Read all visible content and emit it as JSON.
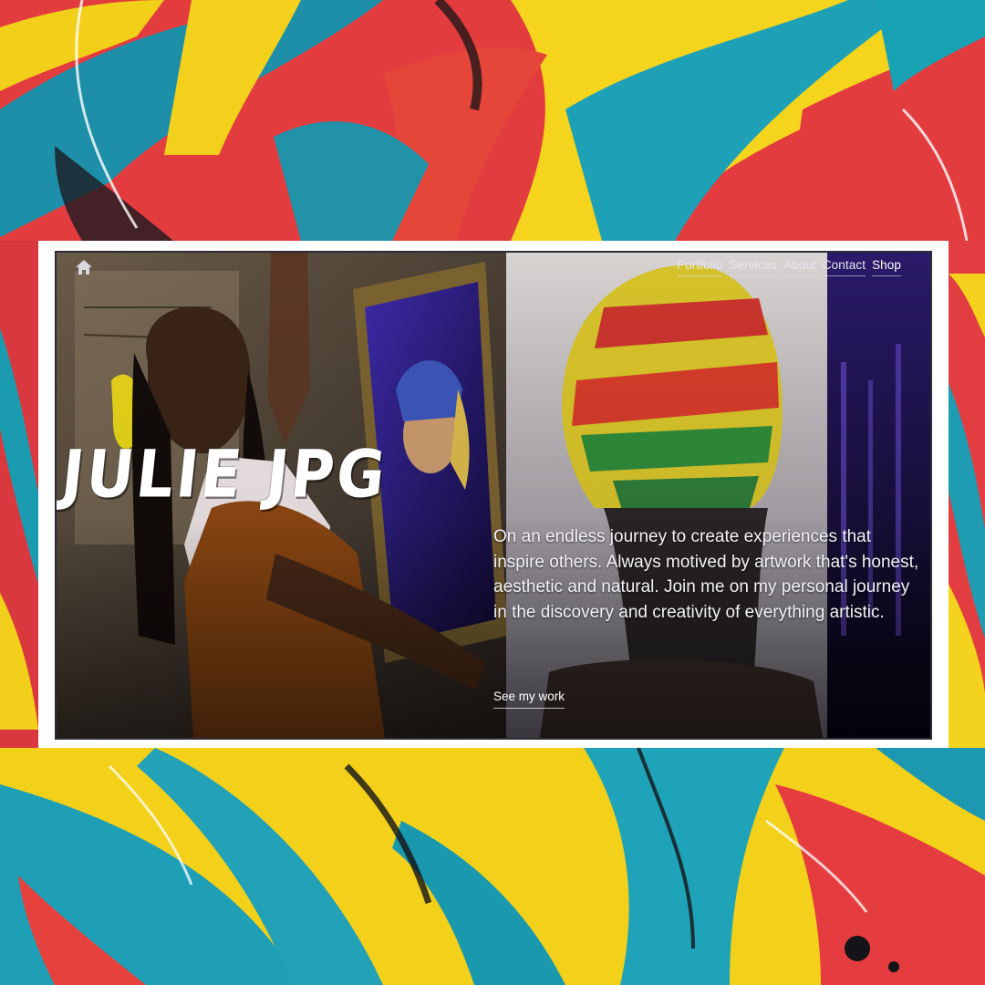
{
  "nav": {
    "home_icon": "home-icon",
    "items": [
      {
        "label": "Portfolio"
      },
      {
        "label": "Services"
      },
      {
        "label": "About"
      },
      {
        "label": "Contact"
      },
      {
        "label": "Shop"
      }
    ]
  },
  "hero": {
    "brand": "JULIE JPG",
    "tagline": "On an endless journey to create experiences that inspire others. Always motived by artwork that's honest, aesthetic and natural. Join me on my personal journey in the discovery and creativity of everything artistic.",
    "cta_label": "See my work"
  },
  "colors": {
    "paint_red": "#e5393e",
    "paint_yellow": "#f4d21a",
    "paint_teal": "#1fa0b5",
    "frame": "#ffffff",
    "text": "#ffffff"
  }
}
